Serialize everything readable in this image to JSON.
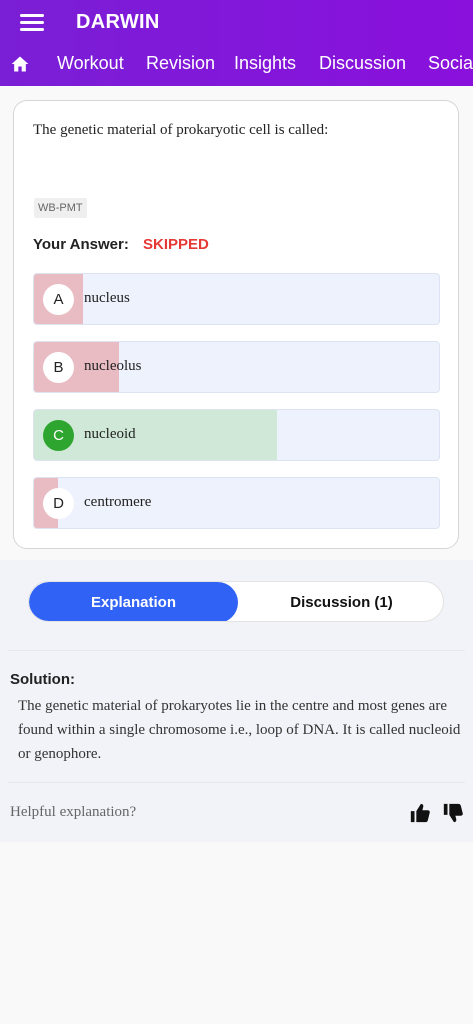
{
  "app": {
    "title": "DARWIN"
  },
  "nav": {
    "tabs": [
      "Workout",
      "Revision",
      "Insights",
      "Discussion",
      "Social"
    ]
  },
  "question": {
    "text": "The genetic material of prokaryotic cell is called:",
    "tag": "WB-PMT",
    "answer_label": "Your Answer:",
    "answer_value": "SKIPPED",
    "options": [
      {
        "letter": "A",
        "text": "nucleus",
        "percent": 12,
        "status": "incorrect"
      },
      {
        "letter": "B",
        "text": "nucleolus",
        "percent": 21,
        "status": "incorrect"
      },
      {
        "letter": "C",
        "text": "nucleoid",
        "percent": 60,
        "status": "correct"
      },
      {
        "letter": "D",
        "text": "centromere",
        "percent": 6,
        "status": "incorrect"
      }
    ]
  },
  "segment": {
    "explanation_label": "Explanation",
    "discussion_label": "Discussion (1)"
  },
  "solution": {
    "heading": "Solution:",
    "body": "The genetic material of prokaryotes lie in the centre and most genes are found within a single chromosome i.e., loop of DNA. It is called nucleoid or genophore.",
    "helpful_prompt": "Helpful explanation?"
  },
  "colors": {
    "appbar": "#7a1fd6",
    "accent": "#2f62f5",
    "skipped": "#e53935",
    "correct": "#2ea52e"
  }
}
